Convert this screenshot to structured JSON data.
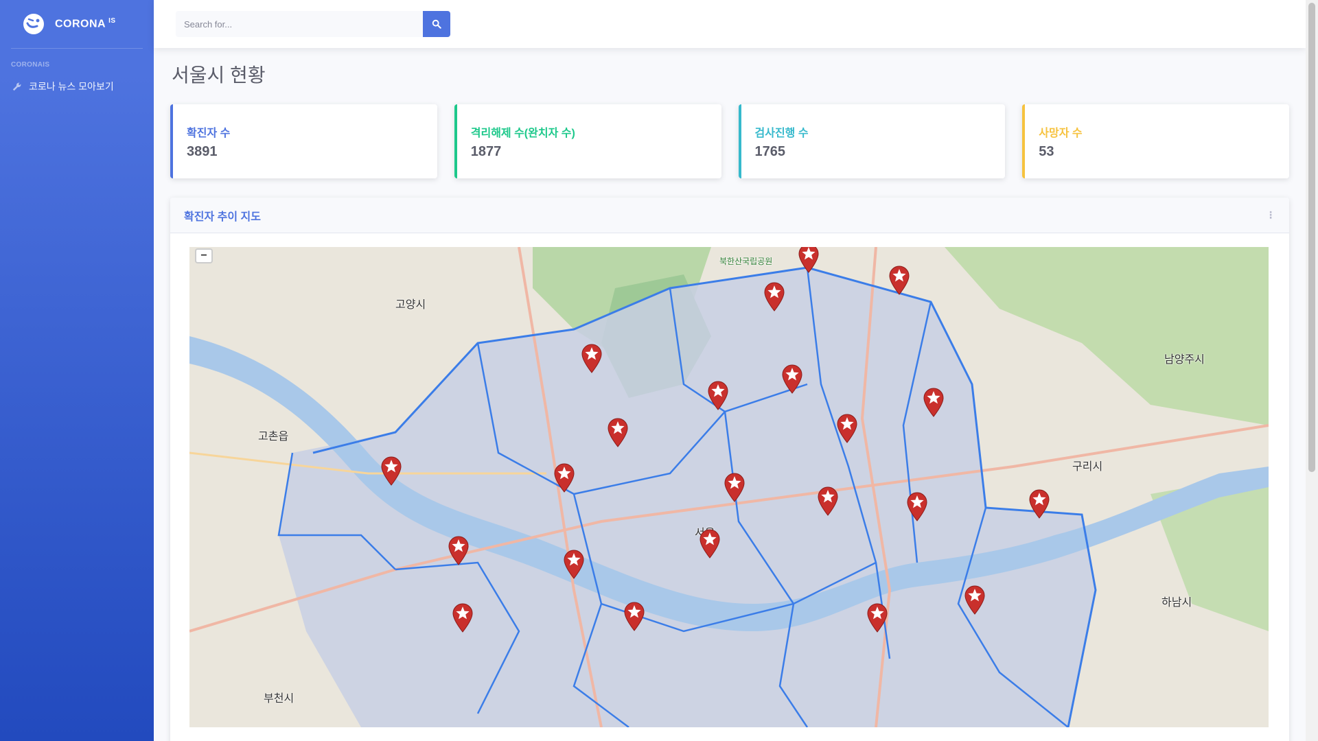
{
  "brand": {
    "name": "CORONA",
    "superscript": "IS"
  },
  "sidebar": {
    "heading": "CORONAIS",
    "items": [
      {
        "label": "코로나 뉴스 모아보기",
        "icon": "wrench-icon"
      }
    ]
  },
  "search": {
    "placeholder": "Search for...",
    "value": "",
    "button_icon": "search-icon"
  },
  "page": {
    "title": "서울시 현황"
  },
  "stats": [
    {
      "label": "확진자 수",
      "value": "3891",
      "color": "#4e73df"
    },
    {
      "label": "격리해제 수(완치자 수)",
      "value": "1877",
      "color": "#1cc88a"
    },
    {
      "label": "검사진행 수",
      "value": "1765",
      "color": "#36b9cc"
    },
    {
      "label": "사망자 수",
      "value": "53",
      "color": "#f6c23e"
    }
  ],
  "map": {
    "title": "확진자 추이 지도",
    "zoom_out_label": "−",
    "places": {
      "gangbuk": "북한산국립공원",
      "goyang": "고양시",
      "guri": "구리시",
      "seoul": "서울",
      "hanam": "하남시",
      "bucheon": "부천시",
      "namyangju": "남양주시",
      "gimpo": "고촌읍"
    },
    "marker_count": 20
  }
}
